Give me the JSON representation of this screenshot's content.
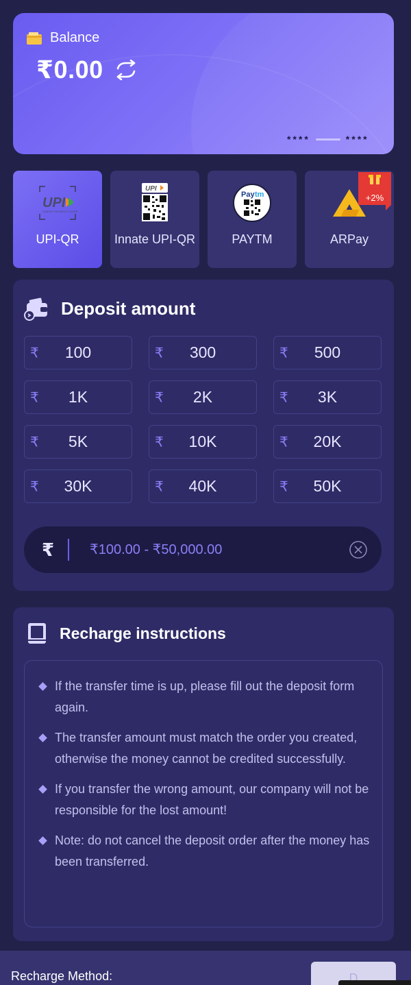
{
  "balance": {
    "label": "Balance",
    "amount": "₹0.00",
    "mask_left": "****",
    "mask_right": "****"
  },
  "methods": [
    {
      "label": "UPI-QR",
      "icon": "upi-icon",
      "active": true
    },
    {
      "label": "Innate UPI-QR",
      "icon": "upi-qr-code-icon",
      "active": false
    },
    {
      "label": "PAYTM",
      "icon": "paytm-qr-icon",
      "active": false
    },
    {
      "label": "ARPay",
      "icon": "arpay-logo-icon",
      "active": false,
      "bonus": "+2%"
    }
  ],
  "deposit": {
    "title": "Deposit amount",
    "currency_symbol": "₹",
    "amounts": [
      "100",
      "300",
      "500",
      "1K",
      "2K",
      "3K",
      "5K",
      "10K",
      "20K",
      "30K",
      "40K",
      "50K"
    ],
    "input_placeholder": "₹100.00 - ₹50,000.00"
  },
  "instructions": {
    "title": "Recharge instructions",
    "items": [
      "If the transfer time is up, please fill out the deposit form again.",
      "The transfer amount must match the order you created, otherwise the money cannot be credited successfully.",
      "If you transfer the wrong amount, our company will not be responsible for the lost amount!",
      "Note: do not cancel the deposit order after the money has been transferred."
    ]
  },
  "footer": {
    "label": "Recharge Method:",
    "button": "D"
  },
  "colors": {
    "accent": "#7c6ff5",
    "panel": "#2e2b66",
    "background": "#22214a"
  }
}
